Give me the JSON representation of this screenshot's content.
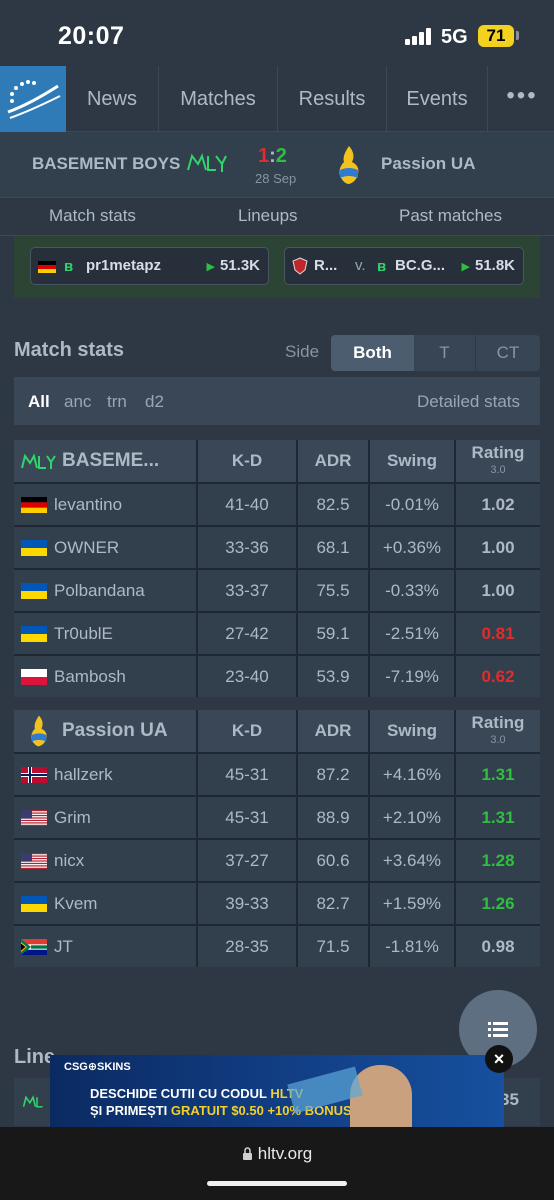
{
  "status": {
    "time": "20:07",
    "network": "5G",
    "battery": "71"
  },
  "nav": {
    "items": [
      "News",
      "Matches",
      "Results",
      "Events"
    ],
    "more": "•••"
  },
  "match": {
    "team1": "BASEMENT BOYS",
    "team2": "Passion UA",
    "score_left": "1",
    "score_sep": ":",
    "score_right": "2",
    "date": "28 Sep"
  },
  "subtabs": [
    "Match stats",
    "Lineups",
    "Past matches"
  ],
  "vods": [
    {
      "name": "pr1metapz",
      "views": "51.3K"
    },
    {
      "name_a": "R...",
      "vs": "v.",
      "name_b": "BC.G...",
      "views": "51.8K"
    }
  ],
  "match_stats": {
    "title": "Match stats",
    "side_label": "Side",
    "side_options": [
      "Both",
      "T",
      "CT"
    ],
    "maps": [
      "All",
      "anc",
      "trn",
      "d2"
    ],
    "detailed": "Detailed stats"
  },
  "columns": {
    "kd": "K-D",
    "adr": "ADR",
    "swing": "Swing",
    "rating": "Rating",
    "rating_ver": "3.0"
  },
  "team1_table": {
    "name": "BASEME...",
    "players": [
      {
        "name": "levantino",
        "flag": "de",
        "kd": "41-40",
        "adr": "82.5",
        "swing": "-0.01%",
        "rating": "1.02",
        "rating_color": "#aeb9c5"
      },
      {
        "name": "OWNER",
        "flag": "ua",
        "kd": "33-36",
        "adr": "68.1",
        "swing": "+0.36%",
        "rating": "1.00",
        "rating_color": "#aeb9c5"
      },
      {
        "name": "Polbandana",
        "flag": "ua",
        "kd": "33-37",
        "adr": "75.5",
        "swing": "-0.33%",
        "rating": "1.00",
        "rating_color": "#aeb9c5"
      },
      {
        "name": "Tr0ublE",
        "flag": "ua",
        "kd": "27-42",
        "adr": "59.1",
        "swing": "-2.51%",
        "rating": "0.81",
        "rating_color": "#e02c2c"
      },
      {
        "name": "Bambosh",
        "flag": "pl",
        "kd": "23-40",
        "adr": "53.9",
        "swing": "-7.19%",
        "rating": "0.62",
        "rating_color": "#e02c2c"
      }
    ]
  },
  "team2_table": {
    "name": "Passion UA",
    "players": [
      {
        "name": "hallzerk",
        "flag": "no",
        "kd": "45-31",
        "adr": "87.2",
        "swing": "+4.16%",
        "rating": "1.31",
        "rating_color": "#2fbf3f"
      },
      {
        "name": "Grim",
        "flag": "us",
        "kd": "45-31",
        "adr": "88.9",
        "swing": "+2.10%",
        "rating": "1.31",
        "rating_color": "#2fbf3f"
      },
      {
        "name": "nicx",
        "flag": "us",
        "kd": "37-27",
        "adr": "60.6",
        "swing": "+3.64%",
        "rating": "1.28",
        "rating_color": "#2fbf3f"
      },
      {
        "name": "Kvem",
        "flag": "ua",
        "kd": "39-33",
        "adr": "82.7",
        "swing": "+1.59%",
        "rating": "1.26",
        "rating_color": "#2fbf3f"
      },
      {
        "name": "JT",
        "flag": "za",
        "kd": "28-35",
        "adr": "71.5",
        "swing": "-1.81%",
        "rating": "0.98",
        "rating_color": "#aeb9c5"
      }
    ]
  },
  "lineups_peek": {
    "title": "Line",
    "number": "35"
  },
  "ad": {
    "brand": "CSG⊕SKINS",
    "line1_a": "DESCHIDE CUTII CU CODUL ",
    "line1_b": "HLTV",
    "line2_a": "ȘI PRIMEȘTI ",
    "line2_b": "GRATUIT $0.50 +10% BONUS"
  },
  "browser": {
    "url": "hltv.org"
  }
}
